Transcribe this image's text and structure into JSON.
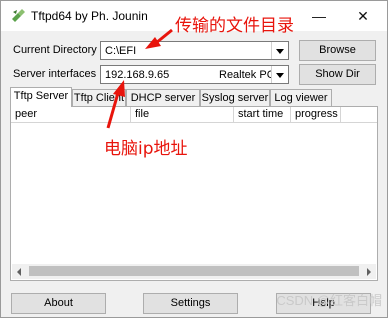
{
  "window": {
    "title": "Tftpd64 by Ph. Jounin",
    "minimize_glyph": "—",
    "close_glyph": "✕"
  },
  "fields": {
    "current_directory_label": "Current Directory",
    "current_directory_value": "C:\\EFI",
    "server_interfaces_label": "Server interfaces",
    "server_interface_ip": "192.168.9.65",
    "server_interface_name": "Realtek PC"
  },
  "buttons": {
    "browse": "Browse",
    "show_dir": "Show Dir",
    "about": "About",
    "settings": "Settings",
    "help": "Help"
  },
  "tabs": [
    {
      "label": "Tftp Server",
      "active": true
    },
    {
      "label": "Tftp Client",
      "active": false
    },
    {
      "label": "DHCP server",
      "active": false
    },
    {
      "label": "Syslog server",
      "active": false
    },
    {
      "label": "Log viewer",
      "active": false
    }
  ],
  "table": {
    "columns": [
      "peer",
      "file",
      "start time",
      "progress"
    ]
  },
  "annotations": {
    "directory_note": "传输的文件目录",
    "ip_note": "电脑ip地址",
    "color": "#e8140c"
  },
  "watermark": "CSDN @红客白帽"
}
